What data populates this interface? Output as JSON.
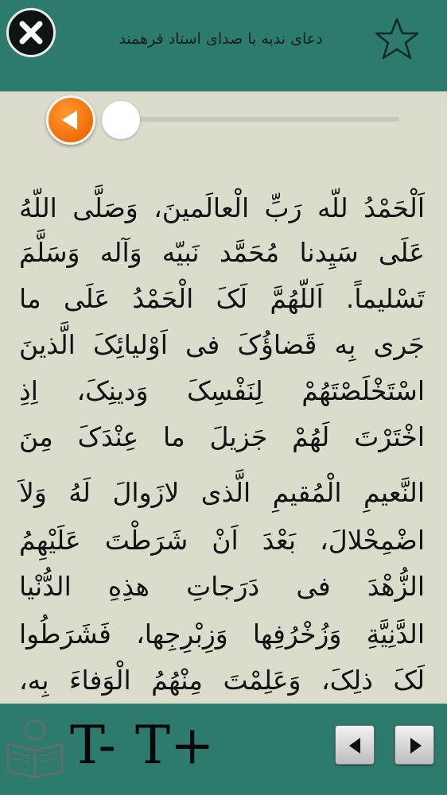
{
  "header": {
    "title": "دعای ندبه با صدای استاد فرهمند",
    "close_icon": "close-icon",
    "favorite_icon": "star-outline-icon"
  },
  "player": {
    "play_icon": "play-back-icon",
    "progress": 0
  },
  "content": {
    "lines": [
      "اَلْحَمْدُ للّه رَبِّ الْعالَمینَ، وَصَلَّی اللّهُ",
      "عَلَی سَیِدنا مُحَمَّد نَبیّه وَآله وَسَلَّمَ",
      "تَسْلیماً. اَللّهُمَّ لَکَ الْحَمْدُ عَلَی ما",
      "جَری بِه قَضاؤُکَ فی اَوْلیائِکَ الَّذینَ",
      "اسْتَخْلَصْتَهُمْ لِنَفْسِکَ وَدینِکَ، اِذِ",
      "اخْتَرْتَ لَهُمْ جَزیلَ ما عِنْدَکَ مِنَ",
      "النَّعیمِ الْمُقیمِ الَّذی لازَوالَ لَهُ وَلاَ",
      "اضْمِحْلالَ، بَعْدَ اَنْ شَرَطْتَ عَلَیْهِمُ",
      "الزُّهْدَ فی دَرَجاتِ هذِهِ الدُّنْیا",
      "الدَّنِیَّةِ وَزُخْرُفِها وَزِبْرِجِها، فَشَرَطُوا",
      "لَکَ ذلِکَ، وَعَلِمْتَ مِنْهُمُ الْوَفاءَ بِه،"
    ]
  },
  "footer": {
    "book_icon": "reader-icon",
    "font_decrease_label": "T-",
    "font_increase_label": "T+",
    "prev_icon": "triangle-left-icon",
    "next_icon": "triangle-right-icon"
  },
  "colors": {
    "bar": "#2d7b6c",
    "page": "#dcdccd",
    "accent": "#f06d06"
  }
}
